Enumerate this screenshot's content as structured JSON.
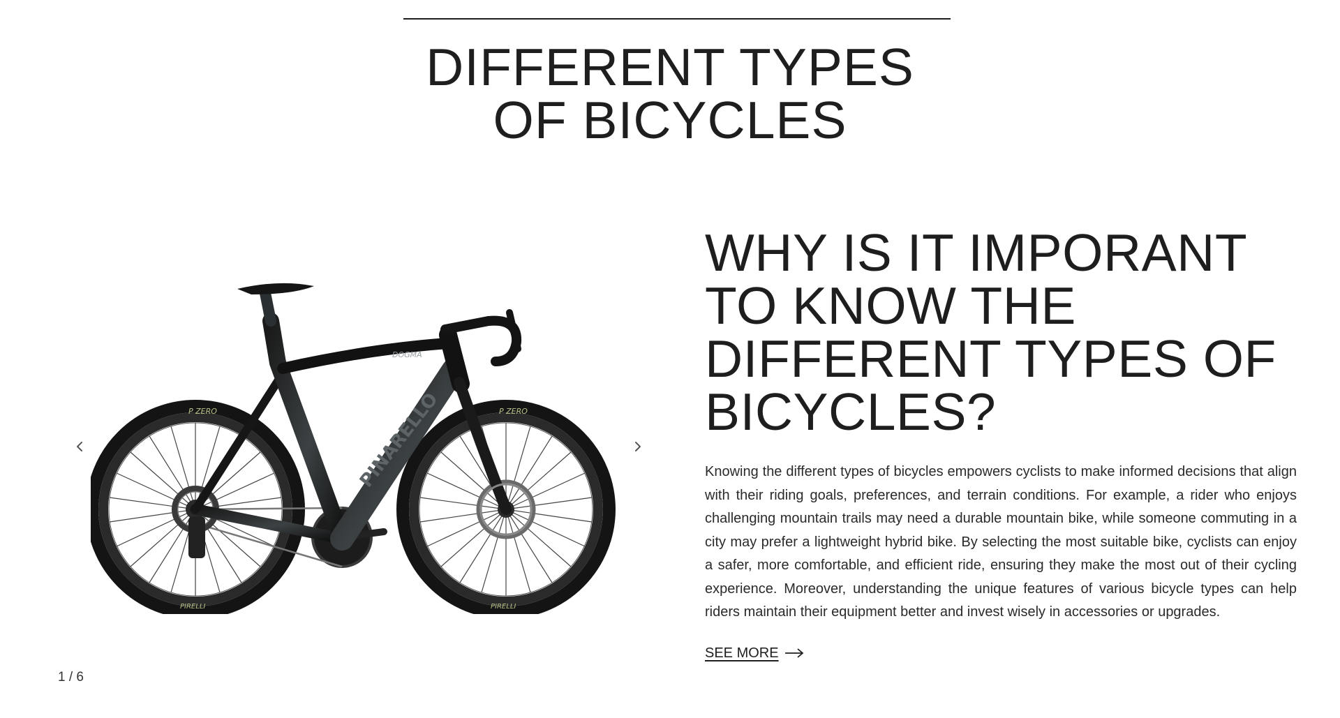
{
  "section": {
    "title_lines": [
      "DIFFERENT TYPES",
      "OF BICYCLES"
    ]
  },
  "carousel": {
    "counter": "1 / 6",
    "prev_icon": "chevron-left-icon",
    "next_icon": "chevron-right-icon",
    "image": "road-bicycle-image",
    "frame_brand": "PINARELLO",
    "frame_model": "DOGMA",
    "tire_text": "P ZERO",
    "tire_brand": "PIRELLI"
  },
  "content": {
    "heading_lines": [
      "WHY IS IT IMPORANT",
      "TO KNOW THE",
      "DIFFERENT TYPES OF",
      "BICYCLES?"
    ],
    "body": "Knowing the different types of bicycles empowers cyclists to make informed decisions that align with their riding goals, preferences, and terrain conditions. For example, a rider who enjoys challenging mountain trails may need a durable mountain bike, while someone commuting in a city may prefer a lightweight hybrid bike. By selecting the most suitable bike, cyclists can enjoy a safer, more comfortable, and efficient ride, ensuring they make the most out of their cycling experience. Moreover, understanding the unique features of various bicycle types can help riders maintain their equipment better and invest wisely in accessories or upgrades.",
    "see_more_label": "SEE MORE",
    "see_more_icon": "arrow-right-icon"
  }
}
